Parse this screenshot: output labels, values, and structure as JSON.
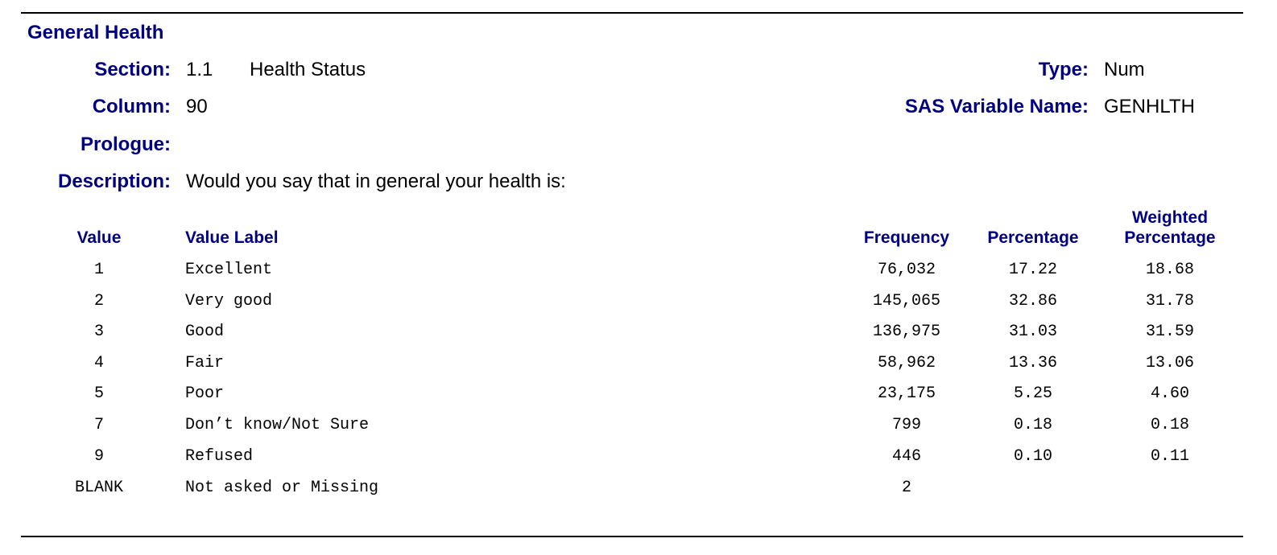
{
  "header": {
    "title": "General Health",
    "section_label": "Section:",
    "section_number": "1.1",
    "section_name": "Health Status",
    "type_label": "Type:",
    "type_value": "Num",
    "column_label": "Column:",
    "column_value": "90",
    "sas_label": "SAS Variable Name:",
    "sas_value": "GENHLTH",
    "prologue_label": "Prologue:",
    "description_label": "Description:",
    "description_value": "Would you say that in general your health is:"
  },
  "table": {
    "headers": {
      "value": "Value",
      "value_label": "Value Label",
      "frequency": "Frequency",
      "percentage": "Percentage",
      "weighted_line1": "Weighted",
      "weighted_line2": "Percentage"
    },
    "rows": [
      {
        "value": "1",
        "label": "Excellent",
        "frequency": "76,032",
        "percentage": "17.22",
        "weighted": "18.68"
      },
      {
        "value": "2",
        "label": "Very good",
        "frequency": "145,065",
        "percentage": "32.86",
        "weighted": "31.78"
      },
      {
        "value": "3",
        "label": "Good",
        "frequency": "136,975",
        "percentage": "31.03",
        "weighted": "31.59"
      },
      {
        "value": "4",
        "label": "Fair",
        "frequency": "58,962",
        "percentage": "13.36",
        "weighted": "13.06"
      },
      {
        "value": "5",
        "label": "Poor",
        "frequency": "23,175",
        "percentage": "5.25",
        "weighted": "4.60"
      },
      {
        "value": "7",
        "label": "Don’t know/Not Sure",
        "frequency": "799",
        "percentage": "0.18",
        "weighted": "0.18"
      },
      {
        "value": "9",
        "label": "Refused",
        "frequency": "446",
        "percentage": "0.10",
        "weighted": "0.11"
      },
      {
        "value": "BLANK",
        "label": "Not asked or Missing",
        "frequency": "2",
        "percentage": "",
        "weighted": ""
      }
    ]
  }
}
